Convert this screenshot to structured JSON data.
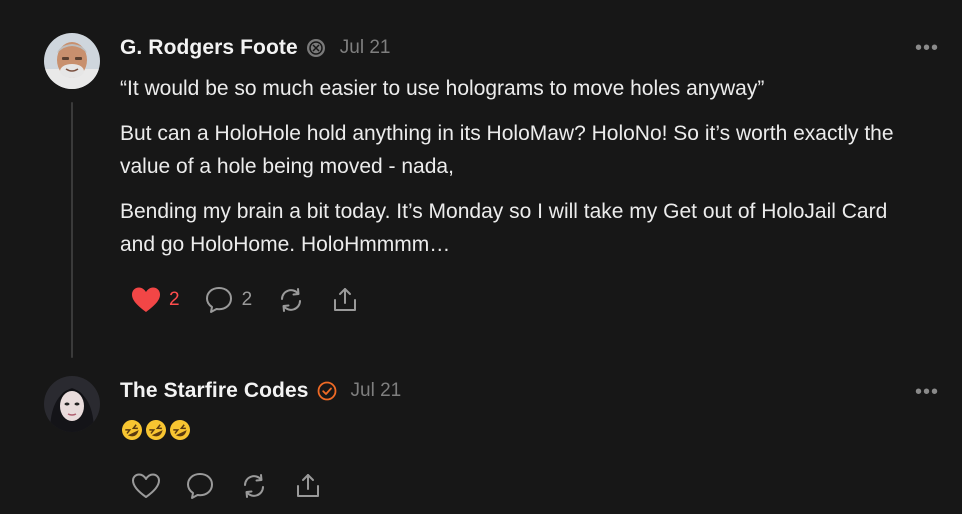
{
  "posts": [
    {
      "author": "G. Rodgers Foote",
      "date": "Jul 21",
      "more": "•••",
      "paragraphs": [
        "“It would be so much easier to use holograms to move holes anyway”",
        "But can a HoloHole hold anything in its HoloMaw? HoloNo! So it’s worth exactly the value of a hole being moved - nada,",
        "Bending my brain a bit today. It’s Monday so I will take my Get out of HoloJail Card and go HoloHome. HoloHmmmm…"
      ],
      "likes": "2",
      "comments": "2",
      "liked": true
    },
    {
      "author": "The Starfire Codes",
      "date": "Jul 21",
      "more": "•••",
      "text": "🤣🤣🤣",
      "emoji_names": [
        "rofl-emoji",
        "rofl-emoji",
        "rofl-emoji"
      ]
    }
  ],
  "colors": {
    "like": "#f24646",
    "badge_orange": "#ef6a25",
    "muted": "#8a8a8a",
    "background": "#171717"
  },
  "icons": [
    "heart-icon",
    "comment-icon",
    "repost-icon",
    "share-icon",
    "more-icon",
    "verified-badge-icon"
  ]
}
